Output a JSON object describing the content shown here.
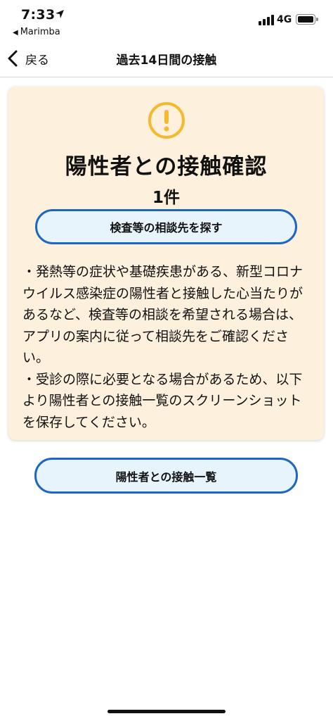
{
  "status_bar": {
    "time": "7:33",
    "back_app": "Marimba",
    "network": "4G"
  },
  "nav": {
    "back_label": "戻る",
    "title": "過去14日間の接触"
  },
  "card": {
    "icon": "warning-circle-icon",
    "icon_color": "#f5b82e",
    "title": "陽性者との接触確認",
    "count": "1件",
    "consult_button": "検査等の相談先を探す",
    "notes": [
      "・発熱等の症状や基礎疾患がある、新型コロナウイルス感染症の陽性者と接触した心当たりがあるなど、検査等の相談を希望される場合は、アプリの案内に従って相談先をご確認ください。",
      "・受診の際に必要となる場合があるため、以下より陽性者との接触一覧のスクリーンショットを保存してください。"
    ],
    "background": "#fdf0dc"
  },
  "list_button": "陽性者との接触一覧",
  "colors": {
    "button_border": "#1f66c1",
    "button_fill": "#e8f4fb"
  }
}
